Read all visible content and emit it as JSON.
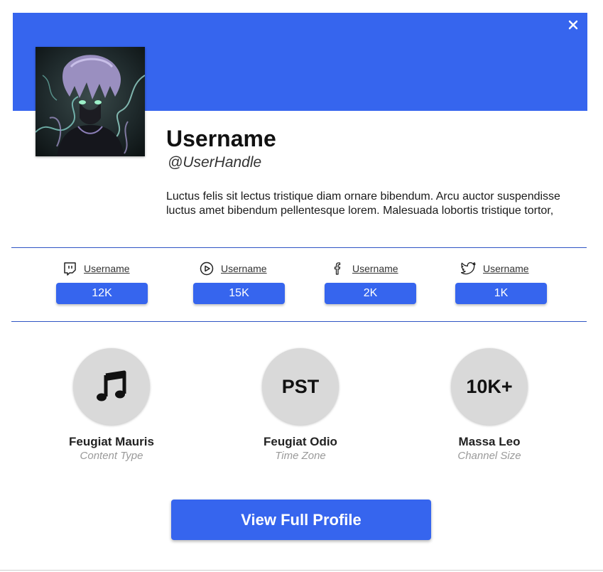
{
  "colors": {
    "accent": "#3665ee",
    "divider": "#2f55c4",
    "circle": "#d9d9d9",
    "muted": "#9a9a9a"
  },
  "header": {
    "close_icon": "close-icon"
  },
  "profile": {
    "username": "Username",
    "handle": "@UserHandle",
    "bio": "Luctus felis sit lectus tristique diam ornare bibendum. Arcu auctor suspendisse luctus amet bibendum pellentesque lorem. Malesuada lobortis tristique tortor,"
  },
  "socials": [
    {
      "platform": "twitch",
      "icon": "twitch-icon",
      "username": "Username",
      "count": "12K"
    },
    {
      "platform": "youtube",
      "icon": "play-icon",
      "username": "Username",
      "count": "15K"
    },
    {
      "platform": "facebook",
      "icon": "facebook-icon",
      "username": "Username",
      "count": "2K"
    },
    {
      "platform": "twitter",
      "icon": "twitter-icon",
      "username": "Username",
      "count": "1K"
    }
  ],
  "stats": [
    {
      "icon": "music-note-icon",
      "badge": "",
      "title": "Feugiat Mauris",
      "subtitle": "Content Type"
    },
    {
      "icon": "",
      "badge": "PST",
      "title": "Feugiat Odio",
      "subtitle": "Time Zone"
    },
    {
      "icon": "",
      "badge": "10K+",
      "title": "Massa Leo",
      "subtitle": "Channel Size"
    }
  ],
  "actions": {
    "view_full_profile": "View Full Profile"
  }
}
